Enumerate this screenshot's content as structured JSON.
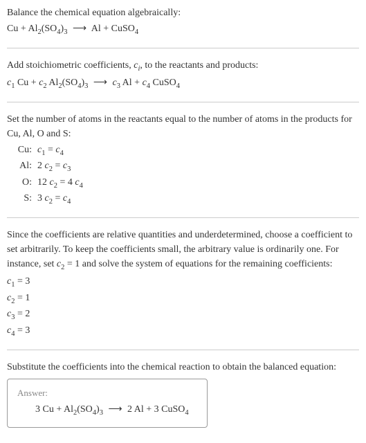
{
  "sec1": {
    "title": "Balance the chemical equation algebraically:",
    "eq_html": "Cu + Al<sub>2</sub>(SO<sub>4</sub>)<sub>3</sub> <span class='arrow'>⟶</span> Al + CuSO<sub>4</sub>"
  },
  "sec2": {
    "title_html": "Add stoichiometric coefficients, <span class='ital'>c<sub>i</sub></span>, to the reactants and products:",
    "eq_html": "<span class='ital'>c</span><sub>1</sub> Cu + <span class='ital'>c</span><sub>2</sub> Al<sub>2</sub>(SO<sub>4</sub>)<sub>3</sub> <span class='arrow'>⟶</span> <span class='ital'>c</span><sub>3</sub> Al + <span class='ital'>c</span><sub>4</sub> CuSO<sub>4</sub>"
  },
  "sec3": {
    "title": "Set the number of atoms in the reactants equal to the number of atoms in the products for Cu, Al, O and S:",
    "rows": [
      {
        "label": "Cu:",
        "eq_html": "<span class='ital'>c</span><sub>1</sub> = <span class='ital'>c</span><sub>4</sub>"
      },
      {
        "label": "Al:",
        "eq_html": "2 <span class='ital'>c</span><sub>2</sub> = <span class='ital'>c</span><sub>3</sub>"
      },
      {
        "label": "O:",
        "eq_html": "12 <span class='ital'>c</span><sub>2</sub> = 4 <span class='ital'>c</span><sub>4</sub>"
      },
      {
        "label": "S:",
        "eq_html": "3 <span class='ital'>c</span><sub>2</sub> = <span class='ital'>c</span><sub>4</sub>"
      }
    ]
  },
  "sec4": {
    "title_html": "Since the coefficients are relative quantities and underdetermined, choose a coefficient to set arbitrarily. To keep the coefficients small, the arbitrary value is ordinarily one. For instance, set <span class='ital'>c</span><sub>2</sub> = 1 and solve the system of equations for the remaining coefficients:",
    "coeffs": [
      "<span class='ital'>c</span><sub>1</sub> = 3",
      "<span class='ital'>c</span><sub>2</sub> = 1",
      "<span class='ital'>c</span><sub>3</sub> = 2",
      "<span class='ital'>c</span><sub>4</sub> = 3"
    ]
  },
  "sec5": {
    "title": "Substitute the coefficients into the chemical reaction to obtain the balanced equation:",
    "answer_label": "Answer:",
    "answer_eq_html": "3 Cu + Al<sub>2</sub>(SO<sub>4</sub>)<sub>3</sub> <span class='arrow'>⟶</span> 2 Al + 3 CuSO<sub>4</sub>"
  }
}
